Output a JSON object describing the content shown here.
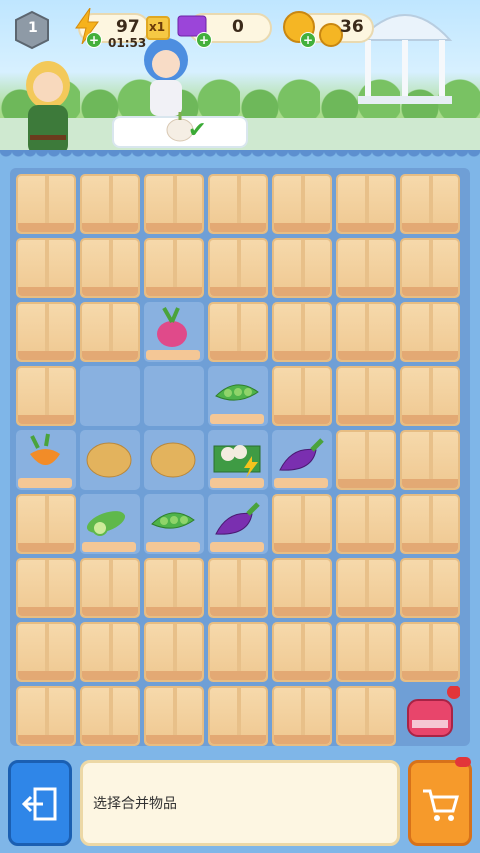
{
  "header": {
    "level": "1",
    "energy": "97",
    "timer": "01:53",
    "multiplier": "x1",
    "gems": "0",
    "coins": "36"
  },
  "board": {
    "rows": [
      [
        "box",
        "box",
        "box",
        "box",
        "box",
        "box",
        "box"
      ],
      [
        "box",
        "box",
        "box",
        "box",
        "box",
        "box",
        "box"
      ],
      [
        "box",
        "box",
        "radish",
        "box",
        "box",
        "box",
        "box"
      ],
      [
        "box",
        "empty",
        "empty",
        "peas",
        "box",
        "box",
        "box"
      ],
      [
        "carrot",
        "potato",
        "potato",
        "crate",
        "eggplant",
        "box",
        "box"
      ],
      [
        "box",
        "cucumber",
        "peas",
        "eggplant",
        "box",
        "box",
        "box"
      ],
      [
        "box",
        "box",
        "box",
        "box",
        "box",
        "box",
        "box"
      ],
      [
        "box",
        "box",
        "box",
        "box",
        "box",
        "box",
        "box"
      ],
      [
        "box",
        "box",
        "box",
        "box",
        "box",
        "box",
        "backpack"
      ]
    ]
  },
  "footer": {
    "message": "选择合并物品"
  },
  "colors": {
    "accent": "#2f86e8",
    "shop": "#f69a2b",
    "board": "#6f9fd6"
  }
}
